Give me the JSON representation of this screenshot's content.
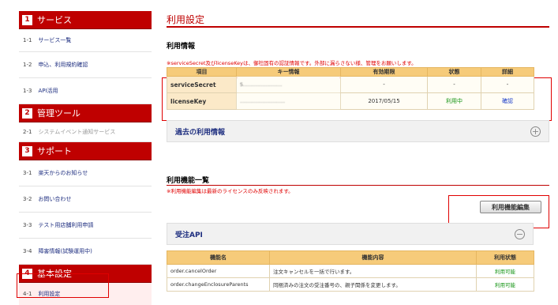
{
  "sidebar": {
    "sections": [
      {
        "num": "1",
        "title": "サービス",
        "items": [
          {
            "no": "1-1",
            "label": "サービス一覧"
          },
          {
            "no": "1-2",
            "label": "申込、利用規約確認"
          },
          {
            "no": "1-3",
            "label": "API活用"
          }
        ]
      },
      {
        "num": "2",
        "title": "管理ツール",
        "items": [
          {
            "no": "2-1",
            "label": "システムイベント通知サービス"
          }
        ]
      },
      {
        "num": "3",
        "title": "サポート",
        "items": [
          {
            "no": "3-1",
            "label": "楽天からのお知らせ"
          },
          {
            "no": "3-2",
            "label": "お問い合わせ"
          },
          {
            "no": "3-3",
            "label": "テスト用店舗利用申請"
          },
          {
            "no": "3-4",
            "label": "障害情報(試験運用中)"
          }
        ]
      },
      {
        "num": "4",
        "title": "基本設定",
        "items": [
          {
            "no": "4-1",
            "label": "利用設定"
          }
        ]
      }
    ]
  },
  "main": {
    "title": "利用設定",
    "info_title": "利用情報",
    "info_notice": "※serviceSecret及びlicenseKeyは、御社固有の認証情報です。外部に漏らさない様、管理をお願いします。",
    "info_table": {
      "headers": [
        "項目",
        "キー情報",
        "有効期限",
        "状態",
        "詳細"
      ],
      "rows": [
        {
          "key": "serviceSecret",
          "value": "S..........................",
          "expiry": "-",
          "status": "-",
          "detail": "-"
        },
        {
          "key": "licenseKey",
          "value": "..............................",
          "expiry": "2017/05/15",
          "status": "利用中",
          "detail": "確認"
        }
      ]
    },
    "past_panel": "過去の利用情報",
    "func_title": "利用機能一覧",
    "func_notice": "※利用機能編集は最新のライセンスのみ反映されます。",
    "edit_button": "利用機能編集",
    "api_panel": "受注API",
    "api_table": {
      "headers": [
        "機能名",
        "機能内容",
        "利用状態"
      ],
      "rows": [
        {
          "name": "order.cancelOrder",
          "desc": "注文キャンセルを一括で行います。",
          "status": "利用可能"
        },
        {
          "name": "order.changeEnclosureParents",
          "desc": "同梱済みの注文の受注番号の、親子関係を変更します。",
          "status": "利用可能"
        }
      ]
    }
  },
  "colors": {
    "brand_red": "#bf0000",
    "highlight": "#e00000",
    "table_header": "#f6cb7a",
    "status_green": "#149414"
  }
}
